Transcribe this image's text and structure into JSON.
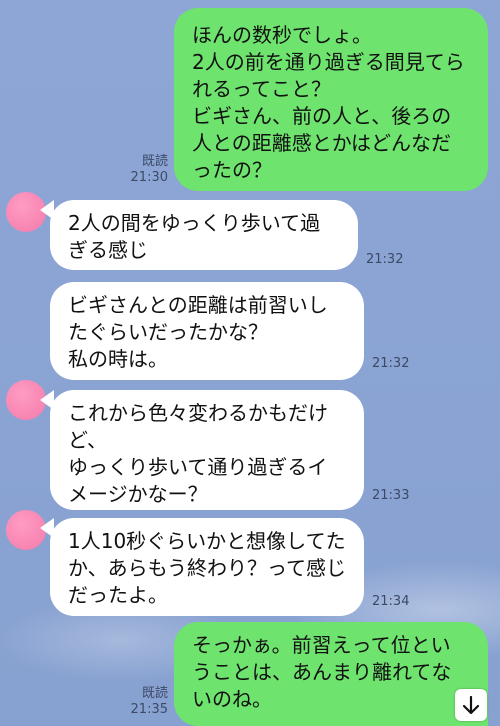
{
  "messages": [
    {
      "direction": "out",
      "text": "ほんの数秒でしょ。\n2人の前を通り過ぎる間見てられるってこと？\nビギさん、前の人と、後ろの人との距離感とかはどんなだったの？",
      "read_label": "既読",
      "time": "21:30"
    },
    {
      "direction": "in",
      "text": "2人の間をゆっくり歩いて過ぎる感じ",
      "time": "21:32"
    },
    {
      "direction": "in",
      "text": "ビギさんとの距離は前習いしたぐらいだったかな？\n私の時は。",
      "time": "21:32"
    },
    {
      "direction": "in",
      "text": "これから色々変わるかもだけど、\nゆっくり歩いて通り過ぎるイメージかなー？",
      "time": "21:33"
    },
    {
      "direction": "in",
      "text": "1人10秒ぐらいかと想像してたか、あらもう終わり？って感じだったよ。",
      "time": "21:34"
    },
    {
      "direction": "out",
      "text": "そっかぁ。前習えって位ということは、あんまり離れてないのね。",
      "read_label": "既読",
      "time": "21:35"
    }
  ],
  "icons": {
    "scroll_down": "arrow-down-icon"
  },
  "colors": {
    "background": "#8aa3d2",
    "outgoing_bubble": "#6ee36e",
    "incoming_bubble": "#ffffff",
    "avatar": "#f47aa9"
  }
}
